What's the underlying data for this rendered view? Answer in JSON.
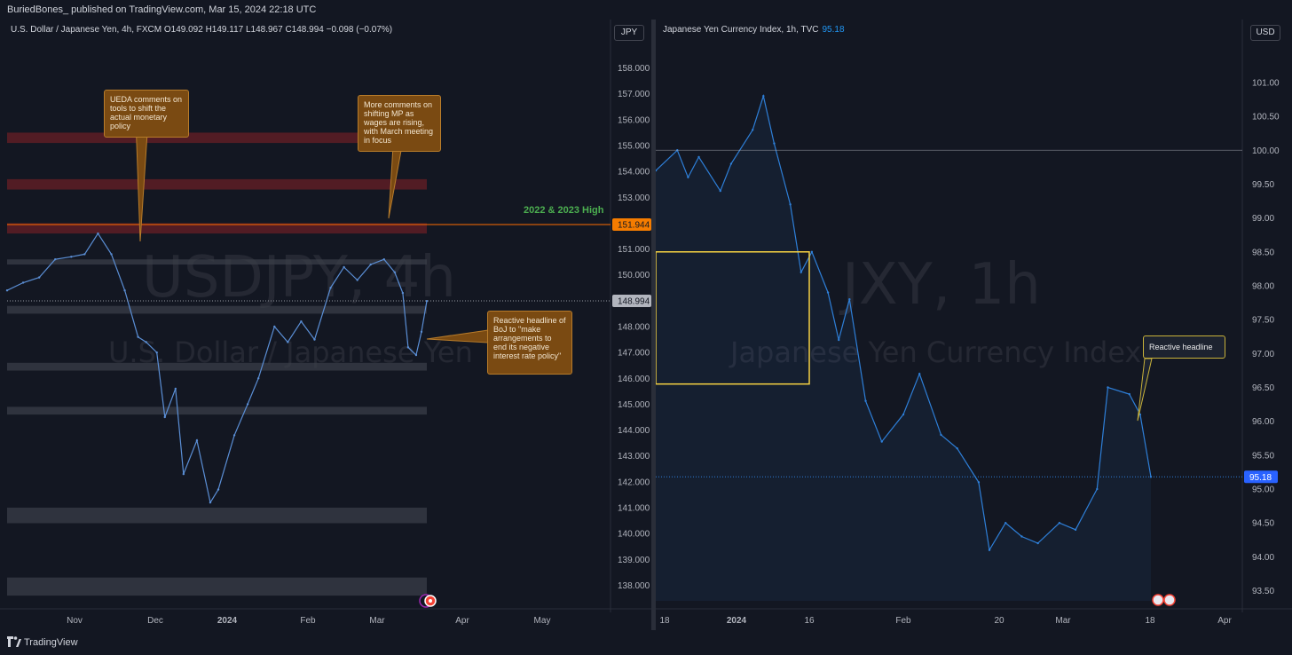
{
  "header": {
    "published_text": "BuriedBones_ published on TradingView.com, Mar 15, 2024 22:18 UTC"
  },
  "footer": {
    "brand": "TradingView"
  },
  "left_panel": {
    "legend": "U.S. Dollar / Japanese Yen, 4h, FXCM  O149.092  H149.117  L148.967  C148.994  −0.098 (−0.07%)",
    "currency": "JPY",
    "watermark_symbol": "USDJPY, 4h",
    "watermark_name": "U.S. Dollar / Japanese Yen",
    "high_label": "2022 & 2023 High",
    "price_tag_high": "151.944",
    "price_tag_last": "148.994",
    "callouts": [
      "UEDA comments on tools to shift the actual monetary policy",
      "More comments on shifting MP as wages are rising, with March meeting in focus",
      "Reactive headline of BoJ to \"make arrangements to end its negative interest rate policy\""
    ],
    "colors": {
      "line": "#5b8fd6",
      "zone_red": "#5e1d24",
      "zone_grey": "#3a3e48",
      "tag_orange": "#f57c00",
      "high_line": "#ff6d00"
    }
  },
  "right_panel": {
    "legend_name": "Japanese Yen Currency Index, 1h, TVC",
    "legend_value": "95.18",
    "currency": "USD",
    "watermark_symbol": "JXY, 1h",
    "watermark_name": "Japanese Yen Currency Index",
    "callout": "Reactive headline",
    "price_tag_last": "95.18",
    "colors": {
      "line": "#2e7fd8",
      "box": "#f5d142",
      "tag_blue": "#2962ff"
    }
  },
  "chart_data": [
    {
      "type": "line",
      "title": "U.S. Dollar / Japanese Yen, 4h, FXCM",
      "x_ticks": [
        "Nov",
        "Dec",
        "2024",
        "Feb",
        "Mar",
        "Apr",
        "May"
      ],
      "y_ticks": [
        "158.000",
        "157.000",
        "156.000",
        "155.000",
        "154.000",
        "153.000",
        "152.000",
        "151.000",
        "150.000",
        "149.000",
        "148.000",
        "147.000",
        "146.000",
        "145.000",
        "144.000",
        "143.000",
        "142.000",
        "141.000",
        "140.000",
        "139.000",
        "138.000"
      ],
      "ylim": [
        137.5,
        158.5
      ],
      "series": [
        {
          "x": [
            "Oct 10",
            "Oct 16",
            "Oct 22",
            "Oct 28",
            "Nov 3",
            "Nov 8",
            "Nov 13",
            "Nov 18",
            "Nov 23",
            "Nov 28",
            "Dec 1",
            "Dec 5",
            "Dec 8",
            "Dec 12",
            "Dec 15",
            "Dec 20",
            "Dec 25",
            "Dec 28",
            "Jan 3",
            "Jan 8",
            "Jan 12",
            "Jan 18",
            "Jan 23",
            "Jan 28",
            "Feb 2",
            "Feb 8",
            "Feb 13",
            "Feb 18",
            "Feb 23",
            "Feb 28",
            "Mar 3",
            "Mar 6",
            "Mar 8",
            "Mar 11",
            "Mar 13",
            "Mar 15"
          ],
          "values": [
            149.4,
            149.7,
            149.9,
            150.6,
            150.7,
            150.8,
            151.6,
            150.8,
            149.4,
            147.6,
            147.4,
            147.0,
            144.5,
            145.6,
            142.3,
            143.6,
            141.2,
            141.7,
            143.8,
            145.0,
            146.0,
            148.0,
            147.4,
            148.2,
            147.5,
            149.5,
            150.3,
            149.8,
            150.4,
            150.6,
            150.1,
            149.3,
            147.2,
            146.9,
            147.8,
            148.99
          ]
        }
      ],
      "zones": [
        [
          155.5,
          155.1
        ],
        [
          153.7,
          153.3
        ],
        [
          152.0,
          151.6
        ],
        [
          150.6,
          150.4
        ],
        [
          148.8,
          148.5
        ],
        [
          146.6,
          146.3
        ],
        [
          144.9,
          144.6
        ],
        [
          141.0,
          140.4
        ],
        [
          138.3,
          137.6
        ]
      ],
      "annotations": [
        "2022 & 2023 High"
      ]
    },
    {
      "type": "line",
      "title": "Japanese Yen Currency Index, 1h, TVC",
      "x_ticks": [
        "18",
        "2024",
        "16",
        "Feb",
        "20",
        "Mar",
        "18",
        "Apr"
      ],
      "y_ticks": [
        "101.00",
        "100.50",
        "100.00",
        "99.50",
        "99.00",
        "98.50",
        "98.00",
        "97.50",
        "97.00",
        "96.50",
        "96.00",
        "95.50",
        "95.00",
        "94.50",
        "94.00",
        "93.50"
      ],
      "ylim": [
        93.35,
        101.3
      ],
      "series": [
        {
          "x": [
            "Dec 14",
            "Dec 18",
            "Dec 20",
            "Dec 22",
            "Dec 26",
            "Dec 28",
            "Jan 1",
            "Jan 3",
            "Jan 5",
            "Jan 8",
            "Jan 10",
            "Jan 12",
            "Jan 15",
            "Jan 17",
            "Jan 19",
            "Jan 22",
            "Jan 25",
            "Jan 29",
            "Feb 1",
            "Feb 5",
            "Feb 8",
            "Feb 12",
            "Feb 14",
            "Feb 17",
            "Feb 20",
            "Feb 23",
            "Feb 27",
            "Mar 1",
            "Mar 5",
            "Mar 7",
            "Mar 11",
            "Mar 13",
            "Mar 15"
          ],
          "values": [
            99.7,
            100.0,
            99.6,
            99.9,
            99.4,
            99.8,
            100.3,
            100.8,
            100.1,
            99.2,
            98.2,
            98.5,
            97.9,
            97.2,
            97.8,
            96.3,
            95.7,
            96.1,
            96.7,
            95.8,
            95.6,
            95.1,
            94.1,
            94.5,
            94.3,
            94.2,
            94.5,
            94.4,
            95.0,
            96.5,
            96.4,
            96.1,
            95.18
          ]
        }
      ],
      "annotations": [
        "Reactive headline"
      ]
    }
  ]
}
